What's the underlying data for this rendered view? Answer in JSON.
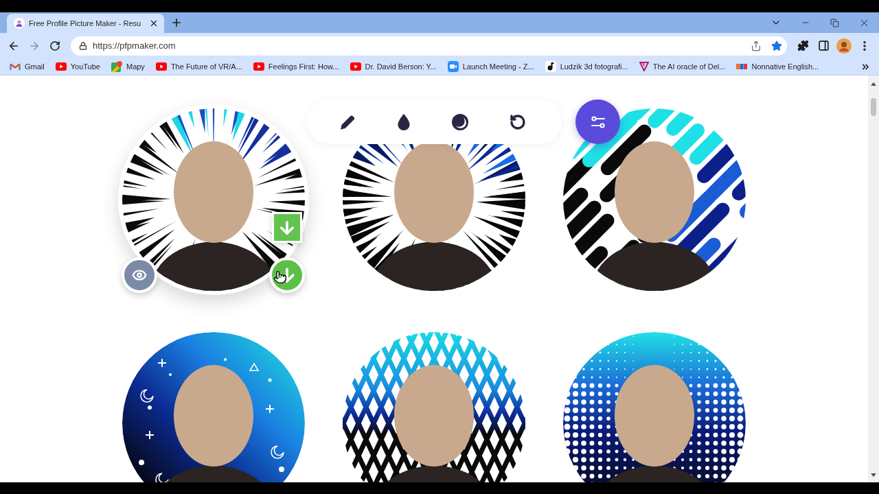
{
  "browser": {
    "tabs": [
      {
        "title": "Free Profile Picture Maker - Resu",
        "selected": true
      }
    ],
    "url": "https://pfpmaker.com",
    "bookmarked": true,
    "bookmarks": [
      {
        "label": "Gmail",
        "kind": "mail"
      },
      {
        "label": "YouTube",
        "kind": "video"
      },
      {
        "label": "Mapy",
        "kind": "map"
      },
      {
        "label": "The Future of VR/A...",
        "kind": "video"
      },
      {
        "label": "Feelings First: How...",
        "kind": "video"
      },
      {
        "label": "Dr. David Berson: Y...",
        "kind": "video"
      },
      {
        "label": "Launch Meeting - Z...",
        "kind": "camera"
      },
      {
        "label": "Ludzik 3d fotografi...",
        "kind": "note"
      },
      {
        "label": "The AI oracle of Del...",
        "kind": "triangle"
      },
      {
        "label": "Nonnative English...",
        "kind": "flag"
      }
    ]
  },
  "gallery": {
    "pictures": [
      {
        "kind": "rays-light",
        "hovered": true
      },
      {
        "kind": "rays-dark",
        "hovered": false
      },
      {
        "kind": "stripes",
        "hovered": false
      },
      {
        "kind": "night-sky",
        "hovered": false
      },
      {
        "kind": "diamonds",
        "hovered": false
      },
      {
        "kind": "halftone",
        "hovered": false
      }
    ]
  }
}
